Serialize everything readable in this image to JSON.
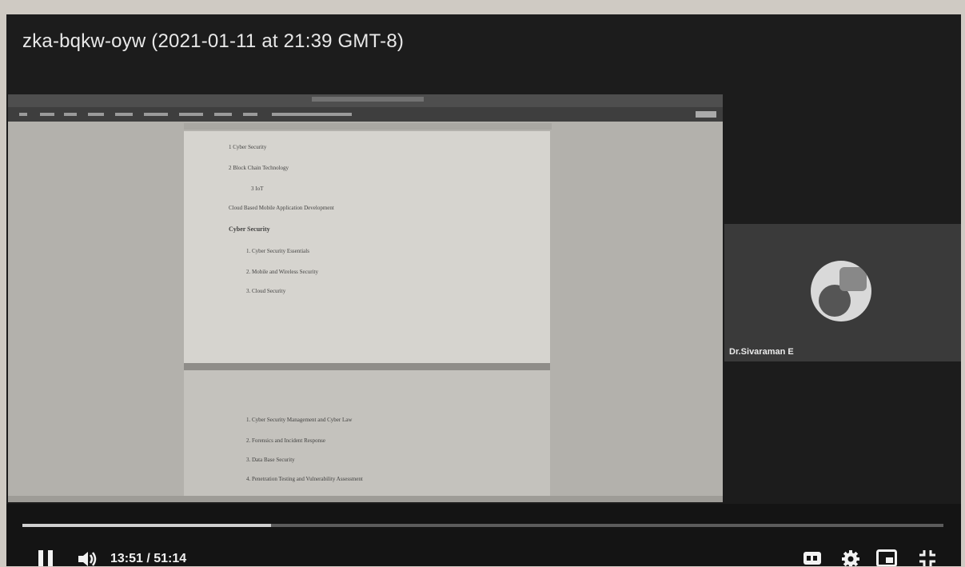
{
  "video": {
    "title": "zka-bqkw-oyw (2021-01-11 at 21:39 GMT-8)"
  },
  "document": {
    "page1_lines": [
      "1 Cyber Security",
      "2 Block Chain Technology",
      "3 IoT",
      "Cloud Based Mobile Application Development",
      "Cyber Security",
      "1. Cyber Security Essentials",
      "2. Mobile and Wireless Security",
      "3. Cloud Security"
    ],
    "page2_lines": [
      "1. Cyber Security Management and Cyber Law",
      "2. Forensics and Incident Response",
      "3. Data Base Security",
      "4. Penetration Testing and Vulnerability Assessment"
    ]
  },
  "participant": {
    "name": "Dr.Sivaraman E"
  },
  "player": {
    "time": "13:51 / 51:14",
    "progress": 0.27,
    "icons": [
      "pause-icon",
      "volume-icon",
      "captions-icon",
      "settings-icon",
      "miniplayer-icon",
      "fullscreen-icon"
    ]
  }
}
